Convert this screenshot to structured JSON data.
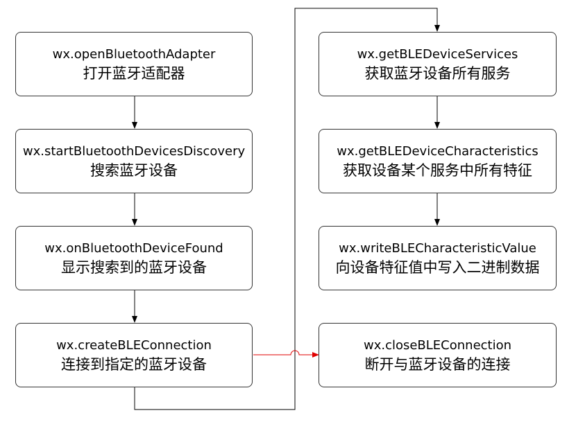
{
  "steps": [
    {
      "api": "wx.openBluetoothAdapter",
      "desc": "打开蓝牙适配器"
    },
    {
      "api": "wx.startBluetoothDevicesDiscovery",
      "desc": "搜索蓝牙设备"
    },
    {
      "api": "wx.onBluetoothDeviceFound",
      "desc": "显示搜索到的蓝牙设备"
    },
    {
      "api": "wx.createBLEConnection",
      "desc": "连接到指定的蓝牙设备"
    },
    {
      "api": "wx.getBLEDeviceServices",
      "desc": "获取蓝牙设备所有服务"
    },
    {
      "api": "wx.getBLEDeviceCharacteristics",
      "desc": "获取设备某个服务中所有特征"
    },
    {
      "api": "wx.writeBLECharacteristicValue",
      "desc": "向设备特征值中写入二进制数据"
    },
    {
      "api": "wx.closeBLEConnection",
      "desc": "断开与蓝牙设备的连接"
    }
  ],
  "colors": {
    "arrow": "#000000",
    "close_arrow": "#e00000",
    "border": "#333333"
  }
}
